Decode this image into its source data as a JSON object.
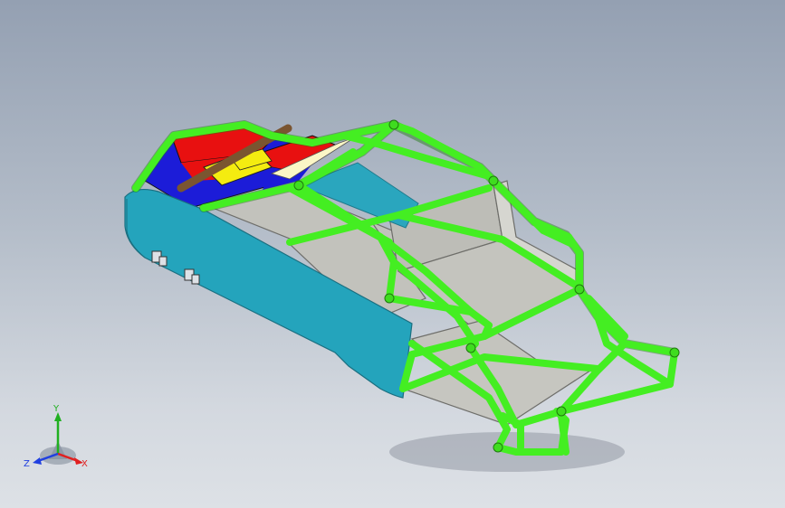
{
  "viewport": {
    "background_top": "#94a0b2",
    "background_bottom": "#dde1e6"
  },
  "model": {
    "frame_color": "#44ee22",
    "side_panel_color": "#24a4bc",
    "floor_color": "#c2c2bc",
    "seat_red": "#e81010",
    "seat_blue": "#1c1cd8",
    "seat_yellow": "#f4ec10",
    "steering_bar_color": "#7a5530"
  },
  "triad": {
    "x_label": "X",
    "y_label": "Y",
    "z_label": "Z",
    "x_color": "#e02020",
    "y_color": "#20b020",
    "z_color": "#2040e0"
  }
}
